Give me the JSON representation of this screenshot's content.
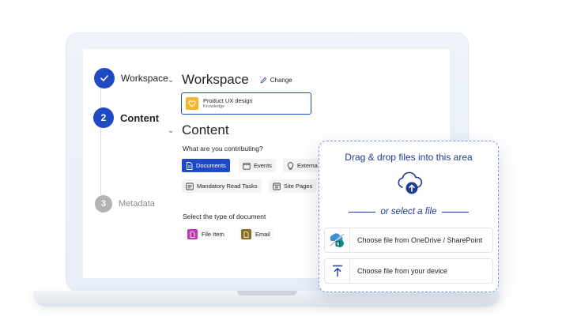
{
  "stepper": {
    "steps": [
      {
        "number": "",
        "label": "Workspace",
        "state": "done"
      },
      {
        "number": "2",
        "label": "Content",
        "state": "active"
      },
      {
        "number": "3",
        "label": "Metadata",
        "state": "pending"
      }
    ]
  },
  "workspace_section": {
    "title": "Workspace",
    "change_label": "Change",
    "selected": {
      "name": "Product UX design",
      "subtitle": "Knowledge"
    }
  },
  "content_section": {
    "title": "Content",
    "question": "What are you contributing?",
    "content_types": [
      {
        "label": "Documents",
        "icon": "document-icon",
        "selected": true
      },
      {
        "label": "Events",
        "icon": "calendar-icon",
        "selected": false
      },
      {
        "label": "Externa",
        "icon": "lightbulb-icon",
        "selected": false
      },
      {
        "label": "Mandatory Read Tasks",
        "icon": "task-list-icon",
        "selected": false
      },
      {
        "label": "Site Pages",
        "icon": "web-page-icon",
        "selected": false
      }
    ],
    "doc_type_prompt": "Select the type of document",
    "doc_types": [
      {
        "label": "File Item",
        "icon": "file-item-icon",
        "color": "#c239b3"
      },
      {
        "label": "Email",
        "icon": "email-doc-icon",
        "color": "#8a6d1f"
      }
    ]
  },
  "upload_panel": {
    "title": "Drag & drop files into this area",
    "or_text": "or select a file",
    "options": [
      {
        "label": "Choose file from OneDrive / SharePoint",
        "icon": "onedrive-sharepoint-icon"
      },
      {
        "label": "Choose file from your device",
        "icon": "upload-arrow-icon"
      }
    ]
  },
  "colors": {
    "accent": "#1f4ac4",
    "upload_text": "#1f3a8f",
    "workspace_icon": "#f7b52c",
    "pending_step": "#b3b3b3"
  }
}
